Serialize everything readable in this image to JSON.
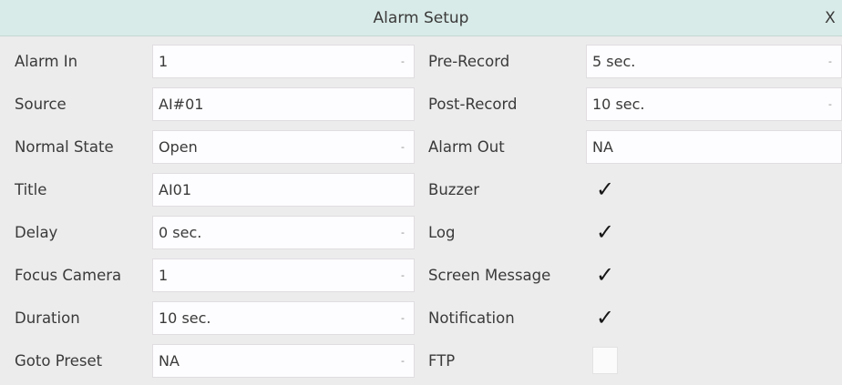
{
  "dialog": {
    "title": "Alarm Setup",
    "close_label": "X"
  },
  "left": {
    "alarm_in": {
      "label": "Alarm In",
      "value": "1"
    },
    "source": {
      "label": "Source",
      "value": "AI#01"
    },
    "normal_state": {
      "label": "Normal State",
      "value": "Open"
    },
    "title": {
      "label": "Title",
      "value": "AI01"
    },
    "delay": {
      "label": "Delay",
      "value": "0 sec."
    },
    "focus_camera": {
      "label": "Focus Camera",
      "value": "1"
    },
    "duration": {
      "label": "Duration",
      "value": "10 sec."
    },
    "goto_preset": {
      "label": "Goto Preset",
      "value": "NA"
    }
  },
  "right": {
    "pre_record": {
      "label": "Pre-Record",
      "value": "5 sec."
    },
    "post_record": {
      "label": "Post-Record",
      "value": "10 sec."
    },
    "alarm_out": {
      "label": "Alarm Out",
      "value": "NA"
    },
    "buzzer": {
      "label": "Buzzer",
      "checked": true
    },
    "log": {
      "label": "Log",
      "checked": true
    },
    "screen_message": {
      "label": "Screen Message",
      "checked": true
    },
    "notification": {
      "label": "Notification",
      "checked": true
    },
    "ftp": {
      "label": "FTP",
      "checked": false
    }
  },
  "glyphs": {
    "check": "✓",
    "caret": "-"
  }
}
